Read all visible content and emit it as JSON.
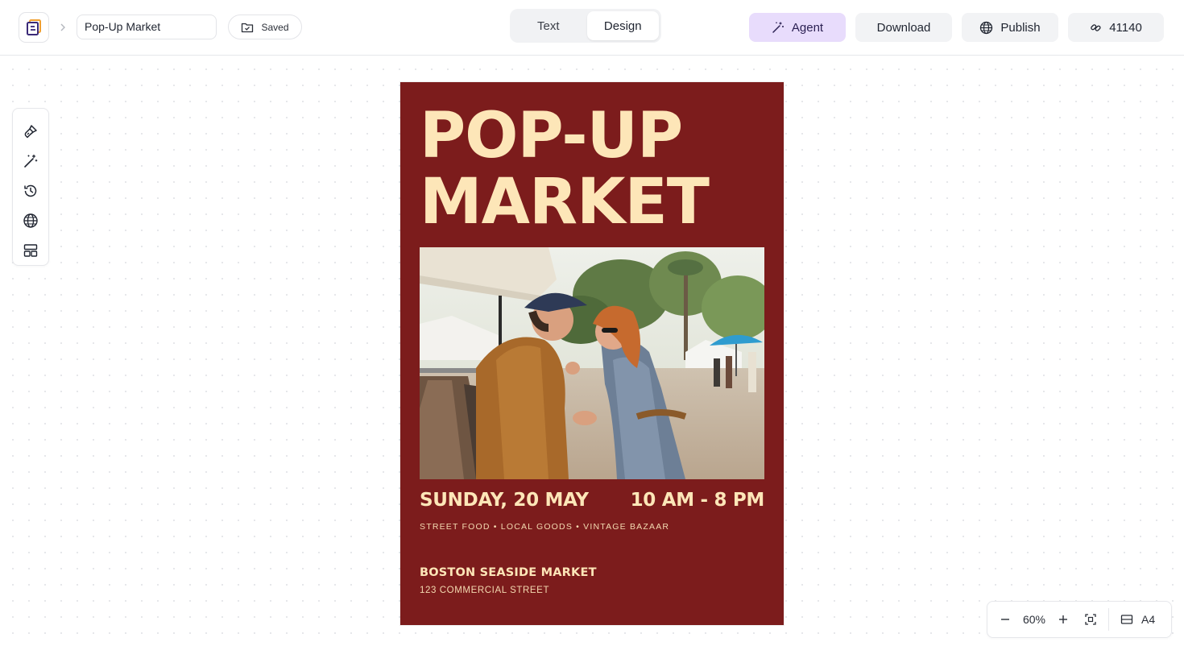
{
  "header": {
    "doc_title": "Pop-Up Market",
    "save_status": "Saved",
    "mode_tabs": [
      {
        "label": "Text",
        "active": false
      },
      {
        "label": "Design",
        "active": true
      }
    ],
    "agent_label": "Agent",
    "download_label": "Download",
    "publish_label": "Publish",
    "collab_count": "41140"
  },
  "toolrail": {
    "items": [
      "brush-icon",
      "magic-wand-icon",
      "history-icon",
      "globe-icon",
      "layout-icon"
    ]
  },
  "poster": {
    "background": "#7c1c1c",
    "accent": "#fde6b8",
    "title": "POP-UP\nMARKET",
    "date": "SUNDAY, 20 MAY",
    "time": "10 AM - 8 PM",
    "tagline": "STREET FOOD • LOCAL GOODS • VINTAGE BAZAAR",
    "venue": "BOSTON SEASIDE MARKET",
    "address": "123 COMMERCIAL STREET"
  },
  "zoom": {
    "level": "60%",
    "page_size": "A4"
  },
  "colors": {
    "agent_bg": "#e8dcfc",
    "button_bg": "#f2f3f5",
    "border": "#e6e7eb"
  }
}
